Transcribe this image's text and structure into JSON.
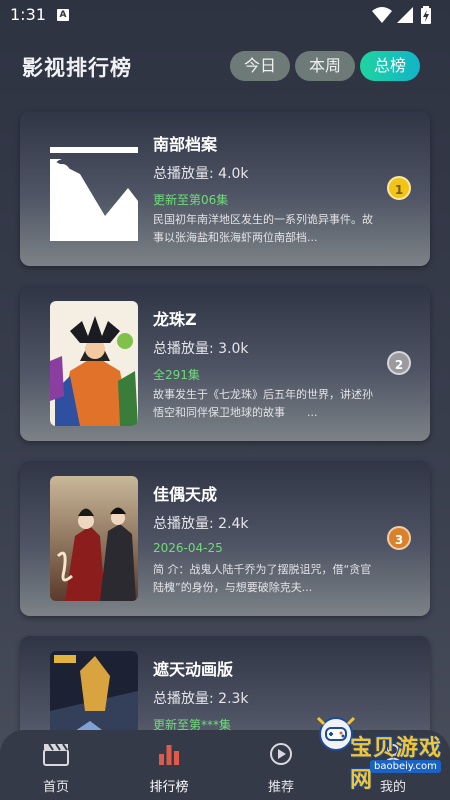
{
  "status_bar": {
    "time": "1:31",
    "notif_badge": "A"
  },
  "header": {
    "title": "影视排行榜",
    "tabs": [
      {
        "label": "今日",
        "active": false
      },
      {
        "label": "本周",
        "active": false
      },
      {
        "label": "总榜",
        "active": true
      }
    ]
  },
  "list": [
    {
      "title": "南部档案",
      "plays": "总播放量: 4.0k",
      "status": "更新至第06集",
      "desc": "民国初年南洋地区发生的一系列诡异事件。故事以张海盐和张海虾两位南部档...",
      "rank": "1"
    },
    {
      "title": "龙珠Z",
      "plays": "总播放量: 3.0k",
      "status": "全291集",
      "desc": "故事发生于《七龙珠》后五年的世界，讲述孙悟空和同伴保卫地球的故事　　...",
      "rank": "2"
    },
    {
      "title": "佳偶天成",
      "plays": "总播放量: 2.4k",
      "status": "2026-04-25",
      "desc": "简 介：战鬼人陆千乔为了摆脱诅咒，借“贪官陆槐”的身份，与想要破除克夫...",
      "rank": "3"
    },
    {
      "title": "遮天动画版",
      "plays": "总播放量: 2.3k",
      "status": "更新至第***集",
      "desc": "",
      "rank": ""
    }
  ],
  "bottom_nav": [
    {
      "label": "首页",
      "icon": "clapperboard-icon"
    },
    {
      "label": "排行榜",
      "icon": "bar-chart-icon"
    },
    {
      "label": "推荐",
      "icon": "play-icon"
    },
    {
      "label": "我的",
      "icon": "user-icon"
    }
  ],
  "watermark": {
    "text": "宝贝游戏网",
    "url": "baobeiy.com"
  },
  "colors": {
    "accent": "#1fd4a0",
    "status_green": "#6fdc7a",
    "gold": "#f2c418",
    "bronze": "#d9822b"
  }
}
